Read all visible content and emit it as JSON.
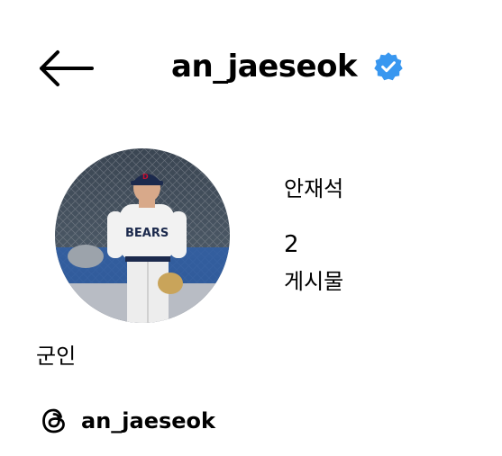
{
  "header": {
    "back_icon": "arrow-left-icon",
    "username": "an_jaeseok",
    "verified_icon": "verified-badge-icon",
    "verified_color": "#3897f0"
  },
  "profile": {
    "avatar": "profile-photo",
    "name": "안재석",
    "post_count": "2",
    "post_label": "게시물",
    "bio": "군인"
  },
  "threads": {
    "icon": "threads-icon",
    "handle": "an_jaeseok"
  }
}
